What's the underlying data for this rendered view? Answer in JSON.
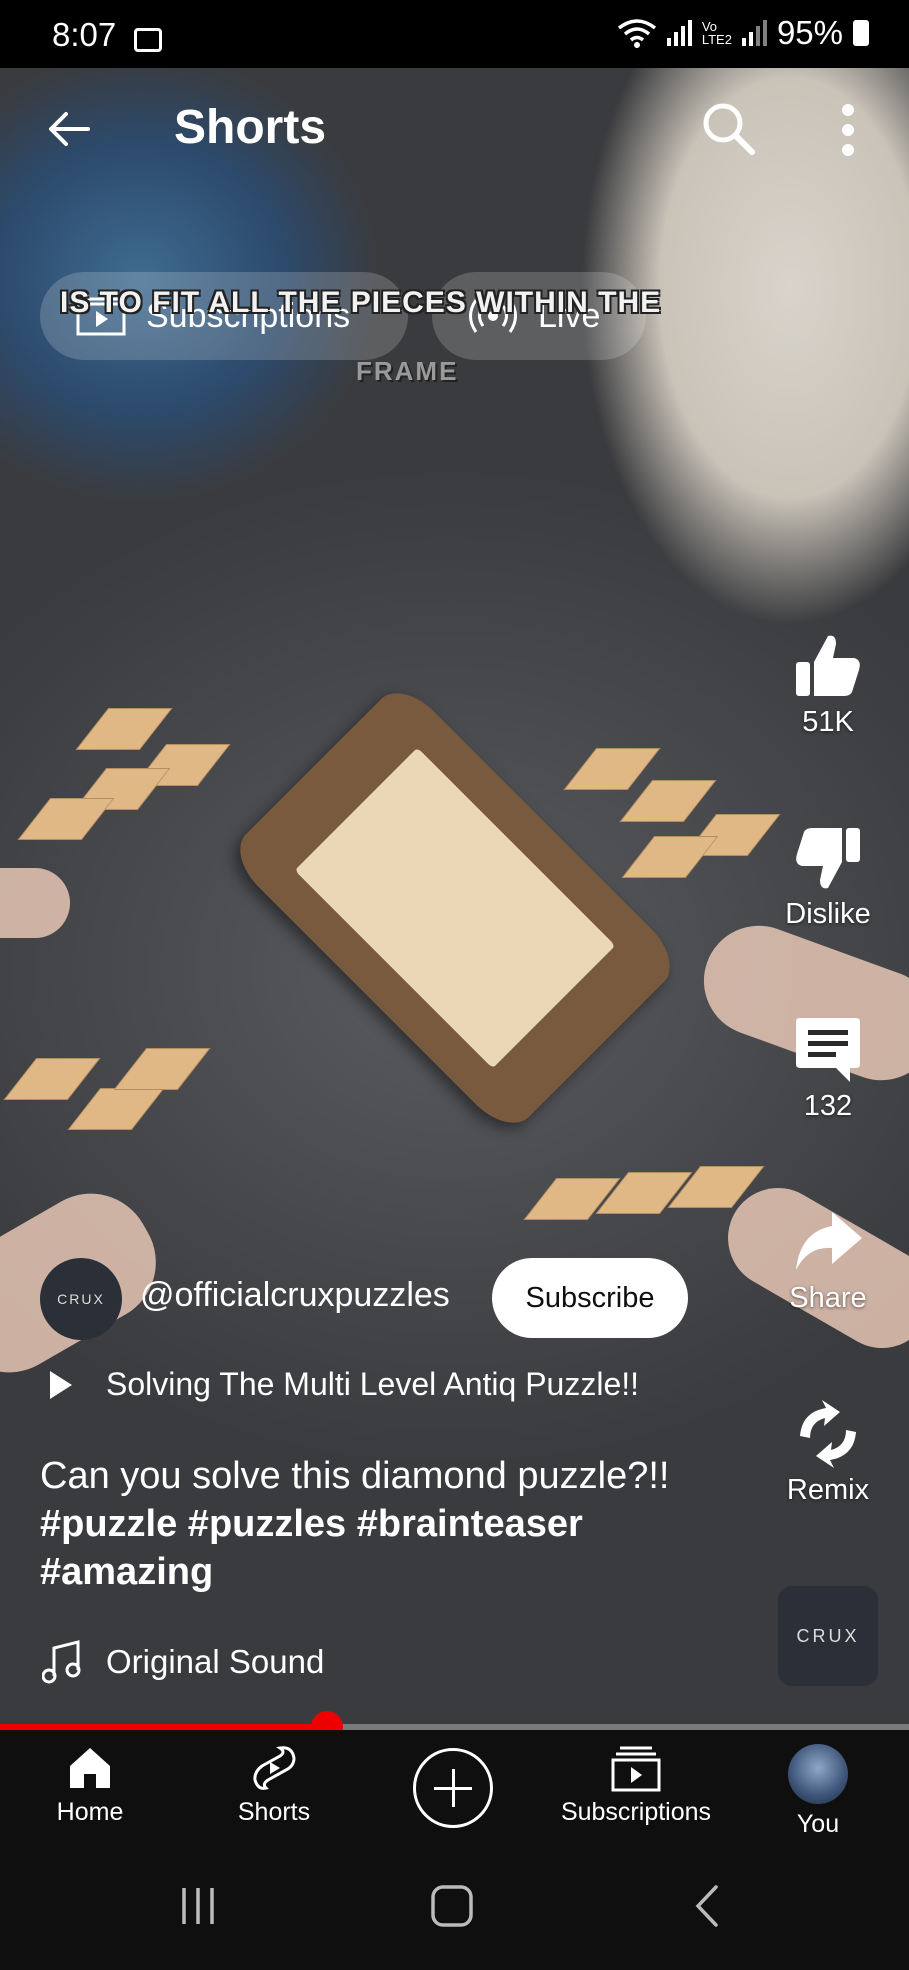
{
  "status_bar": {
    "time": "8:07",
    "battery": "95%",
    "icons": [
      "image-notification-icon",
      "wifi-icon",
      "signal-icon",
      "volte-icon",
      "battery-icon"
    ]
  },
  "header": {
    "title": "Shorts"
  },
  "feed_tabs": [
    {
      "label": "Subscriptions",
      "icon": "subscriptions-icon"
    },
    {
      "label": "Live",
      "icon": "live-icon"
    }
  ],
  "video_caption": {
    "line1": "IS TO FIT ALL THE PIECES WITHIN THE",
    "line2": "FRAME"
  },
  "actions": {
    "like_count": "51K",
    "dislike_label": "Dislike",
    "comment_count": "132",
    "share_label": "Share",
    "remix_label": "Remix"
  },
  "channel": {
    "avatar_text": "CRUX",
    "handle": "@officialcruxpuzzles",
    "subscribe_label": "Subscribe"
  },
  "related_video": "Solving The Multi Level Antiq Puzzle!!",
  "description": {
    "text": "Can you solve this diamond puzzle?!!",
    "hashtags_line1": "#puzzle #puzzles #brainteaser",
    "hashtags_line2": "#amazing"
  },
  "sound": {
    "label": "Original Sound",
    "thumb_text": "CRUX"
  },
  "progress": {
    "fraction": 0.36
  },
  "bottom_nav": [
    {
      "label": "Home"
    },
    {
      "label": "Shorts"
    },
    {
      "label": "Subscriptions"
    },
    {
      "label": "You"
    }
  ],
  "colors": {
    "accent_red": "#ee0000",
    "nav_bg": "#0f0f0f"
  }
}
